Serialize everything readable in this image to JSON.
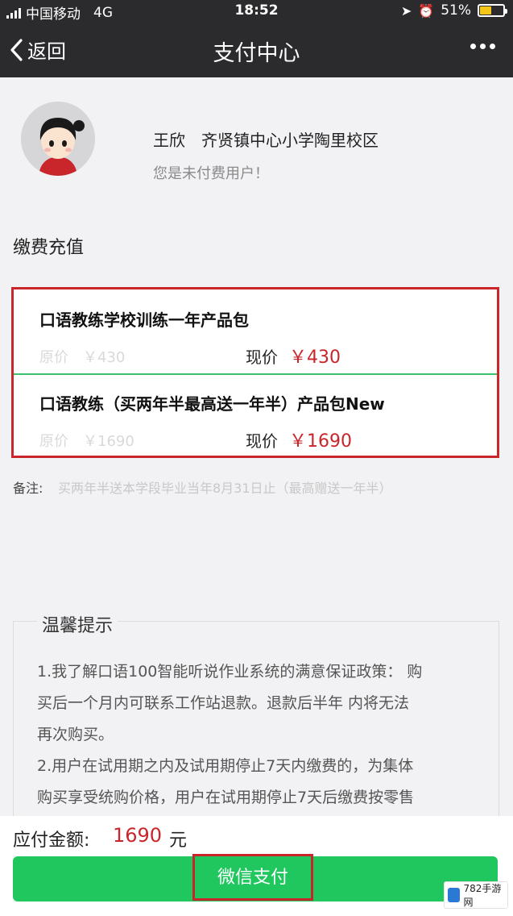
{
  "status_bar": {
    "carrier": "中国移动",
    "network": "4G",
    "time": "18:52",
    "battery": "51%",
    "battery_level": 0.51
  },
  "nav": {
    "back_label": "返回",
    "title": "支付中心"
  },
  "user": {
    "name_school": "王欣　齐贤镇中心小学陶里校区",
    "status": "您是未付费用户！"
  },
  "section_title": "缴费充值",
  "packages": [
    {
      "name": "口语教练学校训练一年产品包",
      "original": "原价　￥430",
      "current_label": "现价",
      "current_price": "￥430"
    },
    {
      "name": "口语教练（买两年半最高送一年半）产品包New",
      "original": "原价　￥1690",
      "current_label": "现价",
      "current_price": "￥1690"
    }
  ],
  "remark": {
    "label": "备注:",
    "text": "买两年半送本学段毕业当年8月31日止（最高赠送一年半）"
  },
  "tips": {
    "title": "温馨提示",
    "lines": [
      "1.我了解口语100智能听说作业系统的满意保证政策： 购",
      "买后一个月内可联系工作站退款。退款后半年 内将无法",
      "再次购买。",
      "2.用户在试用期之内及试用期停止7天内缴费的，为集体",
      "购买享受统购价格，用户在试用期停止7天后缴费按零售"
    ]
  },
  "payment": {
    "amount_label": "应付金额:",
    "amount_value": "1690",
    "amount_unit": "元",
    "pay_button": "微信支付"
  },
  "watermark": {
    "text": "782手游网"
  },
  "colors": {
    "accent_red": "#c9262b",
    "wechat_green": "#1fc75e",
    "header_dark": "#2b2b2e"
  }
}
